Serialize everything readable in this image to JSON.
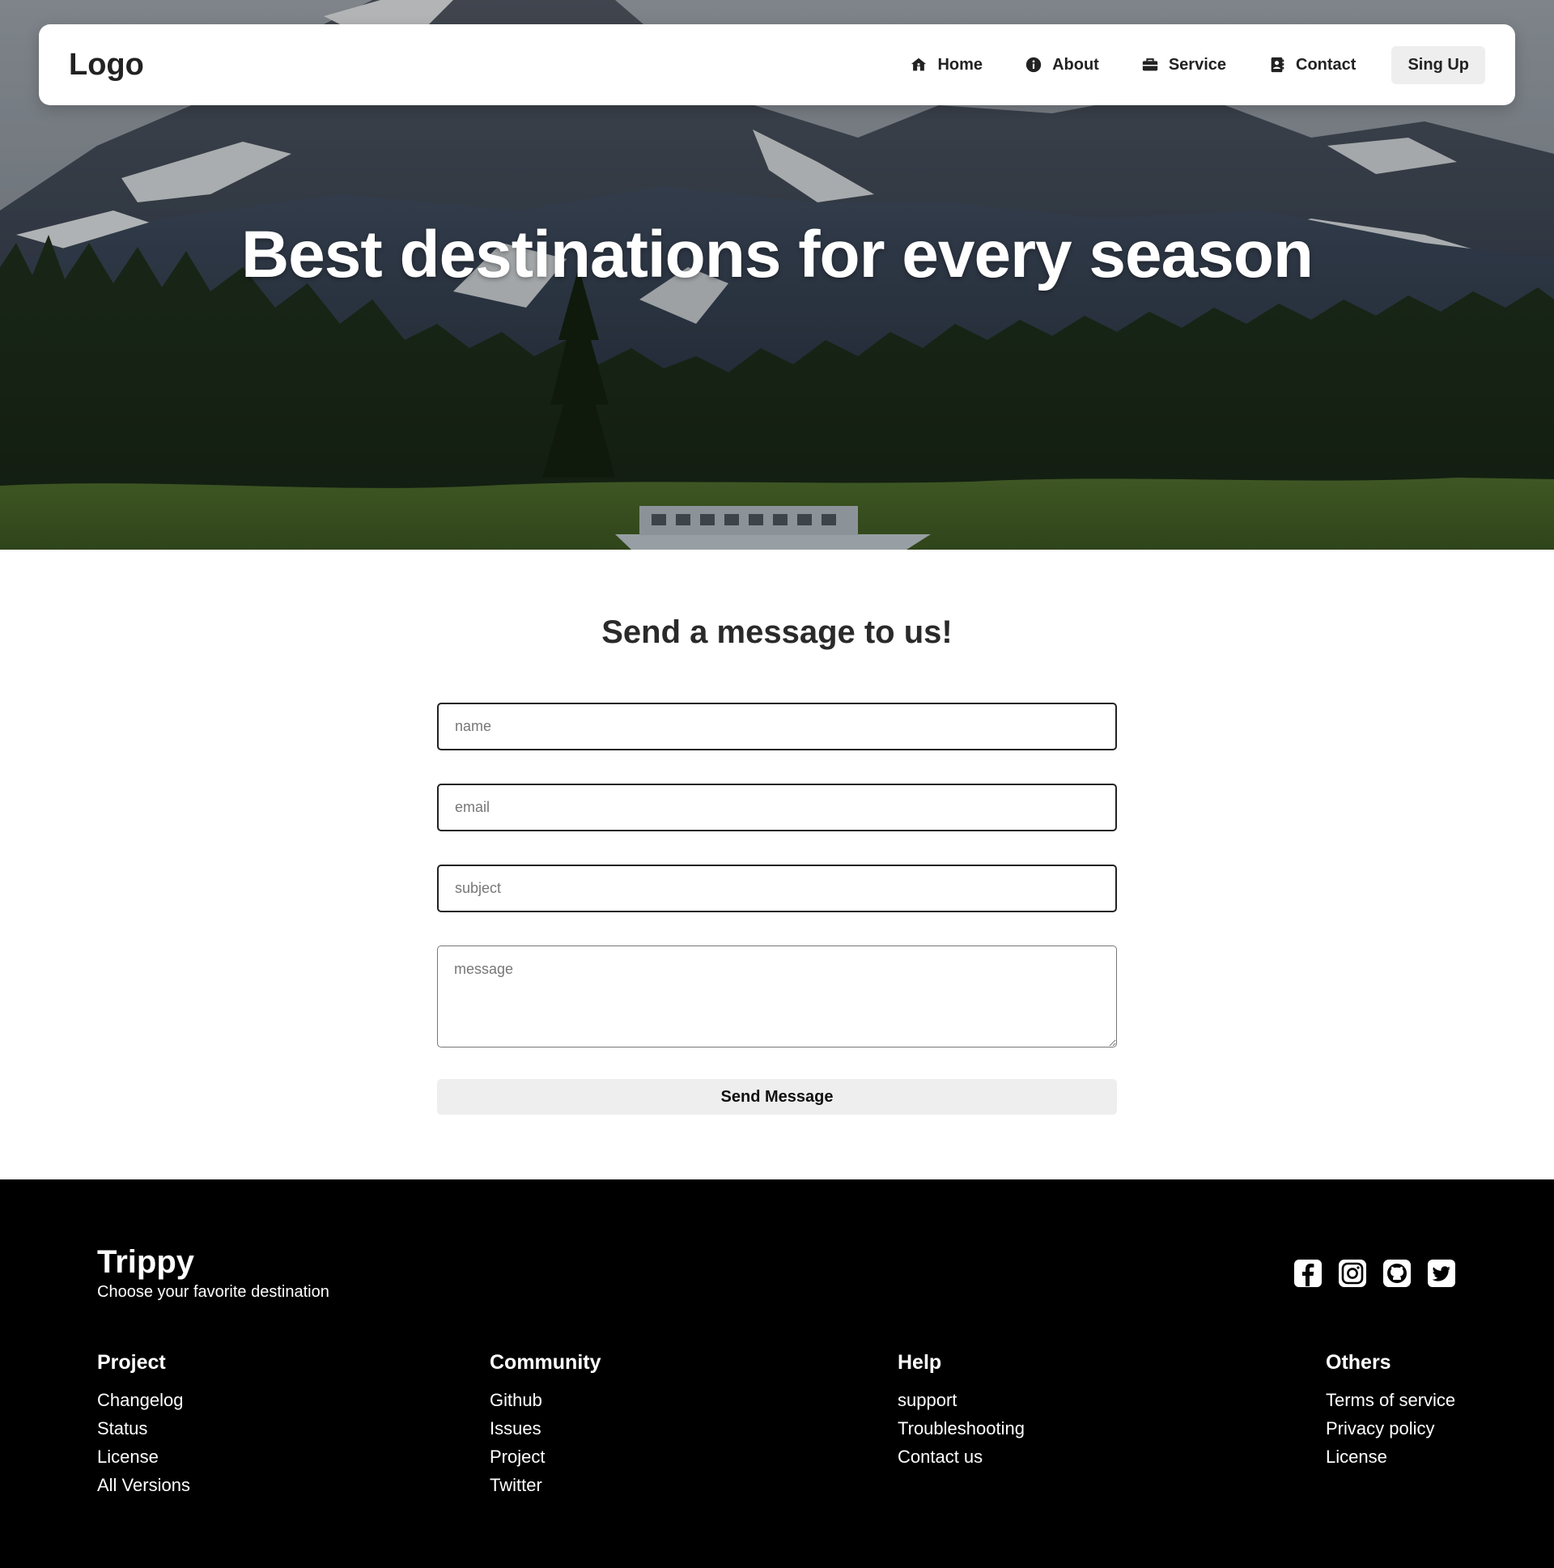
{
  "navbar": {
    "logo": "Logo",
    "links": [
      {
        "label": "Home",
        "icon": "home-icon"
      },
      {
        "label": "About",
        "icon": "info-icon"
      },
      {
        "label": "Service",
        "icon": "briefcase-icon"
      },
      {
        "label": "Contact",
        "icon": "contact-card-icon"
      }
    ],
    "signup_label": "Sing Up"
  },
  "hero": {
    "title": "Best destinations for every season"
  },
  "contact_form": {
    "heading": "Send a message to us!",
    "name_placeholder": "name",
    "email_placeholder": "email",
    "subject_placeholder": "subject",
    "message_placeholder": "message",
    "submit_label": "Send Message"
  },
  "footer": {
    "brand": "Trippy",
    "tagline": "Choose your favorite destination",
    "socials": [
      "facebook-icon",
      "instagram-icon",
      "github-icon",
      "twitter-icon"
    ],
    "columns": [
      {
        "title": "Project",
        "links": [
          "Changelog",
          "Status",
          "License",
          "All Versions"
        ]
      },
      {
        "title": "Community",
        "links": [
          "Github",
          "Issues",
          "Project",
          "Twitter"
        ]
      },
      {
        "title": "Help",
        "links": [
          "support",
          "Troubleshooting",
          "Contact us"
        ]
      },
      {
        "title": "Others",
        "links": [
          "Terms of service",
          "Privacy policy",
          "License"
        ]
      }
    ]
  },
  "colors": {
    "accent_button": "#eeeeee",
    "footer_bg": "#000000",
    "text": "#222222"
  }
}
